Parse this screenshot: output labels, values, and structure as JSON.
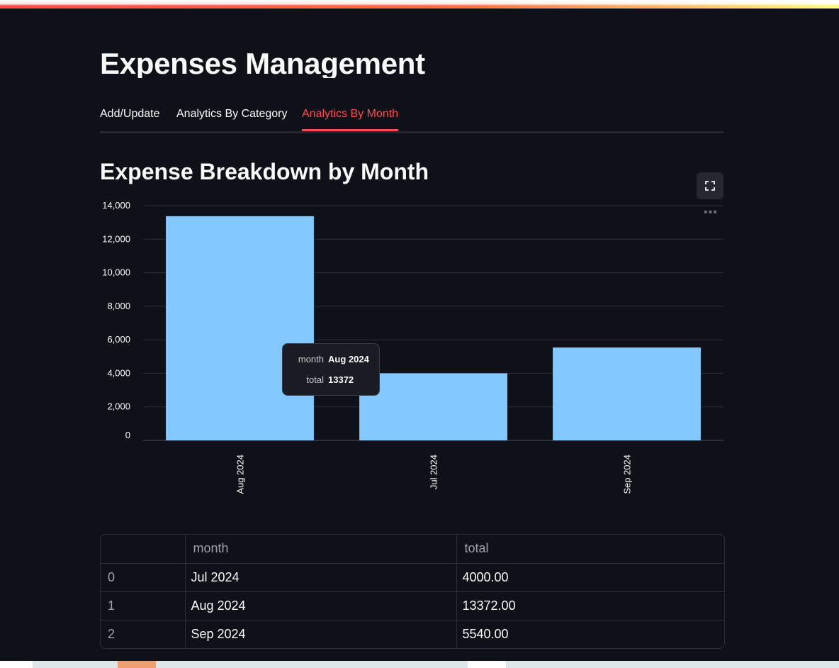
{
  "app": {
    "title": "Expenses Management",
    "accent": "#ff4b4b",
    "background": "#0e1117"
  },
  "tabs": [
    {
      "label": "Add/Update",
      "active": false
    },
    {
      "label": "Analytics By Category",
      "active": false
    },
    {
      "label": "Analytics By Month",
      "active": true
    }
  ],
  "section": {
    "title": "Expense Breakdown by Month",
    "fullscreen_icon": "fullscreen-icon",
    "more_icon": "more-options-icon"
  },
  "chart_data": {
    "type": "bar",
    "categories": [
      "Aug 2024",
      "Jul 2024",
      "Sep 2024"
    ],
    "values": [
      13372,
      4000,
      5540
    ],
    "title": "",
    "xlabel": "",
    "ylabel": "",
    "ylim": [
      0,
      14000
    ],
    "yticks": [
      0,
      2000,
      4000,
      6000,
      8000,
      10000,
      12000,
      14000
    ],
    "ytick_labels": [
      "0",
      "2,000",
      "4,000",
      "6,000",
      "8,000",
      "10,000",
      "12,000",
      "14,000"
    ],
    "bar_color": "#83c9ff",
    "grid": true,
    "legend": "none"
  },
  "tooltip": {
    "rows": [
      {
        "key": "month",
        "value": "Aug 2024"
      },
      {
        "key": "total",
        "value": "13372"
      }
    ]
  },
  "table": {
    "columns": [
      "",
      "month",
      "total"
    ],
    "rows": [
      {
        "index": "0",
        "month": "Jul 2024",
        "total": "4000.00"
      },
      {
        "index": "1",
        "month": "Aug 2024",
        "total": "13372.00"
      },
      {
        "index": "2",
        "month": "Sep 2024",
        "total": "5540.00"
      }
    ]
  }
}
